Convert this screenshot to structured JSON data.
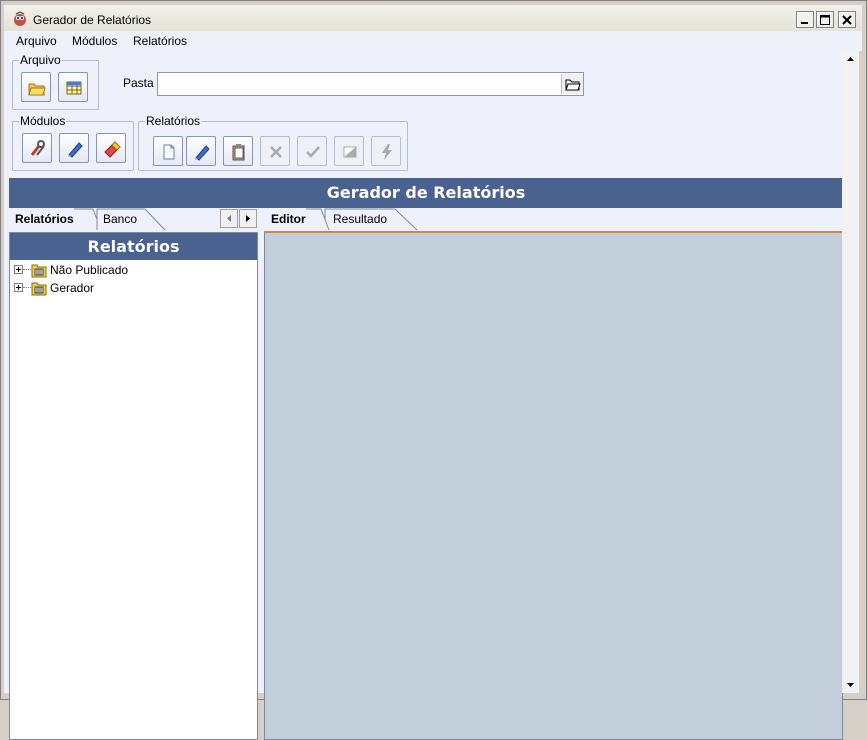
{
  "window": {
    "title": "Gerador de Relatórios"
  },
  "menu": {
    "items": [
      "Arquivo",
      "Módulos",
      "Relatórios"
    ]
  },
  "toolbar": {
    "arquivo_label": "Arquivo",
    "modulos_label": "Módulos",
    "relatorios_label": "Relatórios",
    "pasta_label": "Pasta",
    "pasta_value": ""
  },
  "banner": {
    "title": "Gerador de Relatórios"
  },
  "left": {
    "tabs": [
      "Relatórios",
      "Banco"
    ],
    "active_tab": "Relatórios",
    "header": "Relatórios",
    "tree": [
      "Não Publicado",
      "Gerador"
    ]
  },
  "right": {
    "tabs": [
      "Editor",
      "Resultado"
    ],
    "active_tab": "Editor"
  },
  "colors": {
    "banner": "#4a6290",
    "editor_bg": "#c2ceda",
    "tab_accent": "#c88a4a"
  }
}
